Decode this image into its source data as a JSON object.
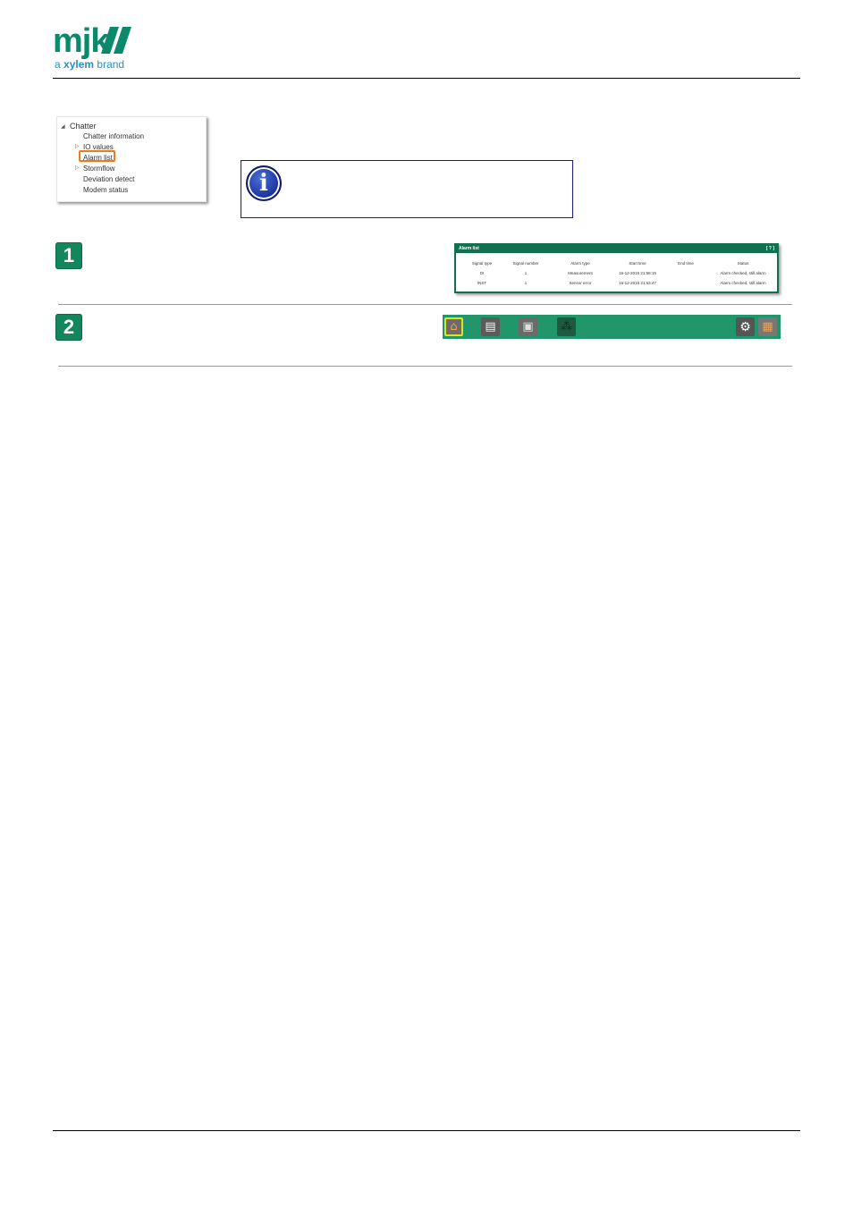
{
  "header": {
    "brand": "mjk",
    "tagline_prefix": "a",
    "tagline_brand": "xylem",
    "tagline_suffix": "brand",
    "brand_color": "#0a8a6a",
    "tagline_color": "#2a8fbf"
  },
  "tree": {
    "root": "Chatter",
    "items": [
      {
        "label": "Chatter information",
        "expandable": false
      },
      {
        "label": "IO values",
        "expandable": true
      },
      {
        "label": "Alarm list",
        "expandable": false,
        "highlighted": true
      },
      {
        "label": "Stormflow",
        "expandable": true
      },
      {
        "label": "Deviation detect",
        "expandable": false
      },
      {
        "label": "Modem status",
        "expandable": false
      }
    ],
    "highlight_color": "#f07a1a"
  },
  "info_box": {
    "icon": "info-icon",
    "border_color": "#1b1b8c"
  },
  "steps": [
    {
      "number": "1"
    },
    {
      "number": "2"
    }
  ],
  "alarm_list": {
    "title": "Alarm list",
    "window_controls": "[ ? ]",
    "columns": [
      "Signal type",
      "Signal number",
      "Alarm type",
      "Start time",
      "End time",
      "Status"
    ],
    "rows": [
      [
        "DI",
        "1",
        "Measurement",
        "16-12-2015 21:58:19",
        "",
        "Alarm checked, still alarm"
      ],
      [
        "INST",
        "1",
        "Sensor error",
        "16-12-2015 21:53:47",
        "",
        "Alarm checked, still alarm"
      ]
    ],
    "accent_color": "#11704f"
  },
  "toolbar": {
    "color": "#21966a",
    "buttons": [
      {
        "name": "home-icon"
      },
      {
        "name": "notes-icon"
      },
      {
        "name": "devices-icon"
      },
      {
        "name": "network-icon"
      },
      {
        "name": "gear-icon"
      },
      {
        "name": "profile-icon"
      }
    ]
  }
}
